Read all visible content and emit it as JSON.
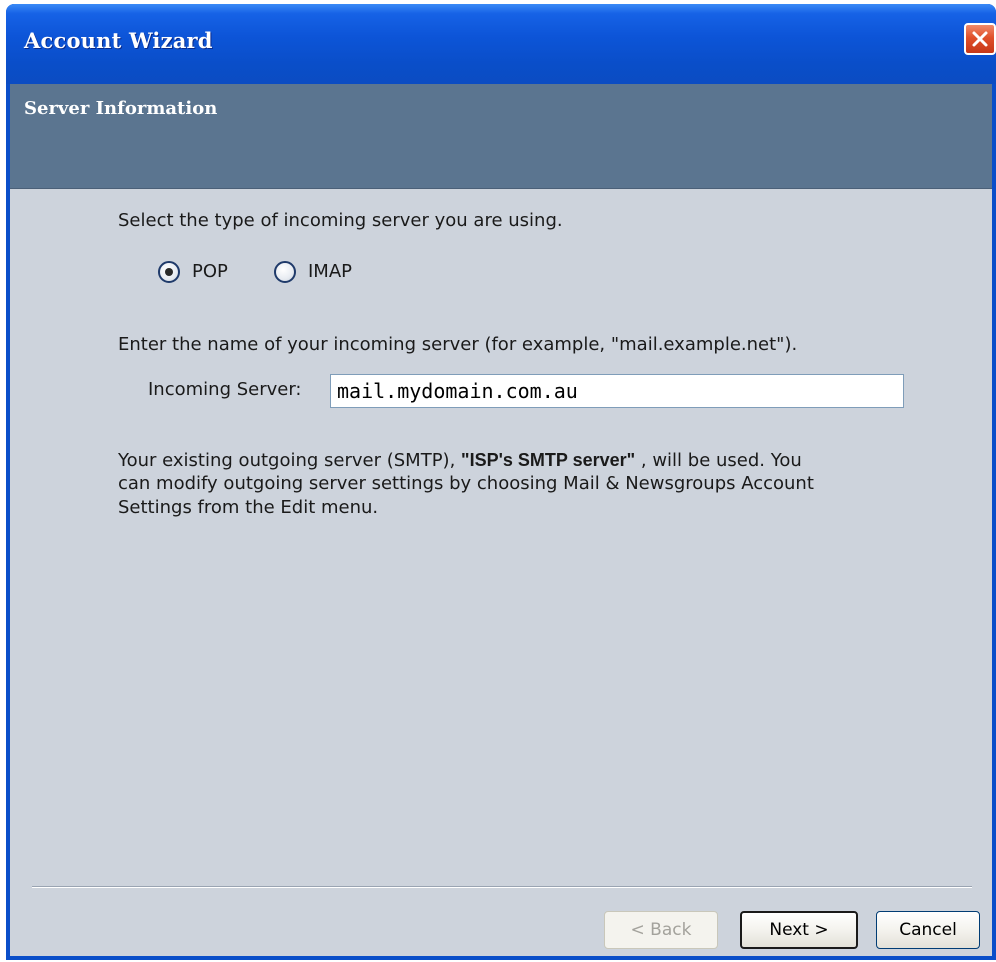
{
  "window": {
    "title": "Account Wizard"
  },
  "header": {
    "title": "Server Information"
  },
  "server_type": {
    "prompt": "Select the type of incoming server you are using.",
    "options": [
      {
        "label": "POP",
        "selected": true
      },
      {
        "label": "IMAP",
        "selected": false
      }
    ]
  },
  "incoming": {
    "prompt": "Enter the name of your incoming server (for example, \"mail.example.net\").",
    "label": "Incoming Server:",
    "value": "mail.mydomain.com.au"
  },
  "outgoing": {
    "note_before": "Your existing outgoing server (SMTP),",
    "server_name": "\"ISP's SMTP server\"",
    "note_after": ", will be used. You",
    "note_line2": "can modify outgoing server settings by choosing Mail & Newsgroups Account",
    "note_line3": "Settings from the Edit menu."
  },
  "buttons": {
    "back": "< Back",
    "next": "Next >",
    "cancel": "Cancel"
  },
  "colors": {
    "titlebar": "#0a4ec9",
    "header_band": "#5b7590",
    "client_bg": "#cdd3dc",
    "close_button": "#e0502a"
  },
  "icons": {
    "close": "close-x-icon"
  }
}
